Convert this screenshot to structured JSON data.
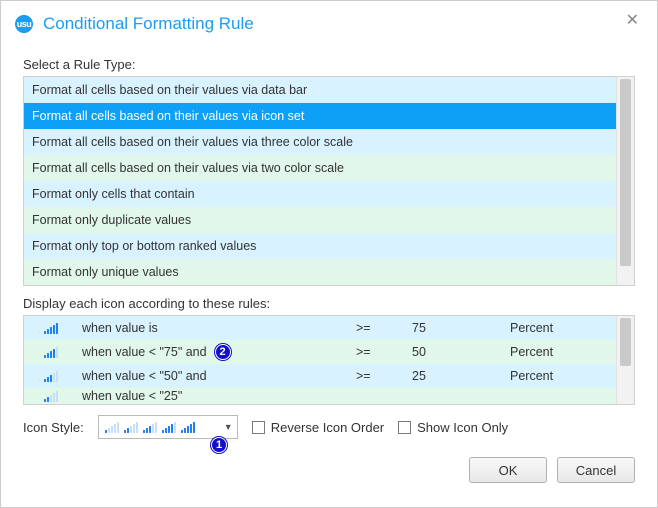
{
  "window": {
    "title": "Conditional Formatting Rule"
  },
  "labels": {
    "select_rule_type": "Select a Rule Type:",
    "display_rules": "Display each icon according to these rules:",
    "icon_style": "Icon Style:"
  },
  "rule_types": {
    "items": [
      "Format all cells based on their values via data bar",
      "Format all cells based on their values via icon set",
      "Format all cells based on their values via three color scale",
      "Format all cells based on their values via two color scale",
      "Format only cells that contain",
      "Format only duplicate values",
      "Format only top or bottom ranked values",
      "Format only unique values"
    ],
    "selected_index": 1
  },
  "icon_rules": {
    "rows": [
      {
        "condition": "when value is",
        "op": ">=",
        "value": "75",
        "type": "Percent"
      },
      {
        "condition": "when value < \"75\" and",
        "op": ">=",
        "value": "50",
        "type": "Percent"
      },
      {
        "condition": "when value < \"50\" and",
        "op": ">=",
        "value": "25",
        "type": "Percent"
      },
      {
        "condition": "when value < \"25\"",
        "op": "",
        "value": "",
        "type": ""
      }
    ]
  },
  "checkboxes": {
    "reverse_icon_order": {
      "label": "Reverse Icon Order",
      "checked": false
    },
    "show_icon_only": {
      "label": "Show Icon Only",
      "checked": false
    }
  },
  "buttons": {
    "ok": "OK",
    "cancel": "Cancel"
  },
  "markers": {
    "one": "1",
    "two": "2"
  }
}
